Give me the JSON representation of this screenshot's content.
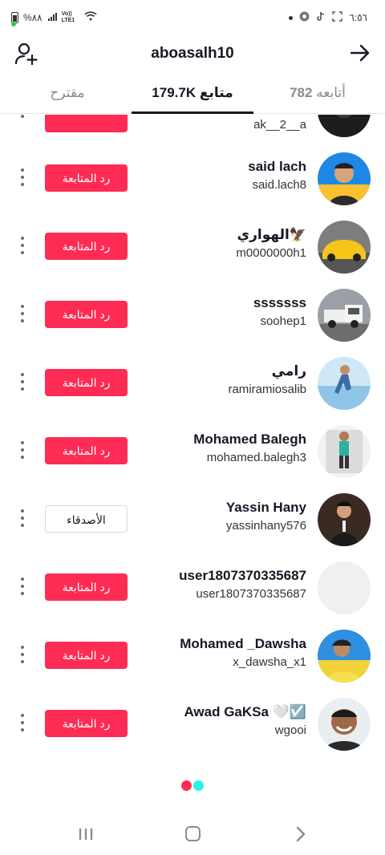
{
  "status_bar": {
    "battery_text": "%٨٨",
    "network_text": "Vo)) LTE1",
    "time": "٦:٥٦"
  },
  "header": {
    "title": "aboasalh10"
  },
  "tabs": {
    "following_count": "782",
    "following_label": "أتابعه",
    "followers_count": "179.7K",
    "followers_label": "متابع",
    "suggested_label": "مقترح"
  },
  "partial_row": {
    "handle": "ak__2__a"
  },
  "rows": [
    {
      "name": "said lach",
      "handle": "said.lach8",
      "button": "رد المتابعة",
      "button_style": "red",
      "avatar": "person-blue-bg"
    },
    {
      "name": "الهواري🦅",
      "handle": "m0000000h1",
      "button": "رد المتابعة",
      "button_style": "red",
      "avatar": "yellow-car"
    },
    {
      "name": "sssssss",
      "handle": "soohep1",
      "button": "رد المتابعة",
      "button_style": "red",
      "avatar": "white-truck"
    },
    {
      "name": "رامي",
      "handle": "ramiramiosalib",
      "button": "رد المتابعة",
      "button_style": "red",
      "avatar": "person-running"
    },
    {
      "name": "Mohamed Balegh",
      "handle": "mohamed.balegh3",
      "button": "رد المتابعة",
      "button_style": "red",
      "avatar": "person-standing"
    },
    {
      "name": "Yassin Hany",
      "handle": "yassinhany576",
      "button": "الأصدقاء",
      "button_style": "gray",
      "avatar": "person-suit"
    },
    {
      "name": "user1807370335687",
      "handle": "user1807370335687",
      "button": "رد المتابعة",
      "button_style": "red",
      "avatar": "default-blank"
    },
    {
      "name": "Mohamed _Dawsha",
      "handle": "x_dawsha_x1",
      "button": "رد المتابعة",
      "button_style": "red",
      "avatar": "person-yellow-shirt"
    },
    {
      "name": "Awad GaKSa 🤍☑️",
      "handle": "wgooi",
      "button": "رد المتابعة",
      "button_style": "red",
      "avatar": "person-smiling"
    }
  ],
  "colors": {
    "accent": "#fe2c55",
    "accent_secondary": "#25f4ee",
    "text_primary": "#161823",
    "text_muted": "#8a8b91"
  }
}
